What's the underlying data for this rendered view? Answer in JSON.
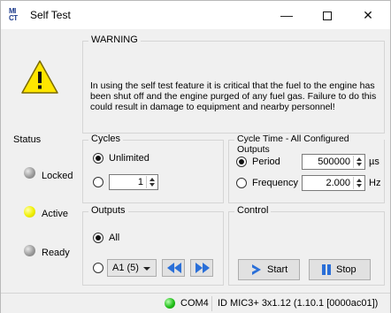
{
  "window": {
    "title": "Self Test",
    "app_icon_text_top": "MI",
    "app_icon_text_bottom": "CT",
    "minimize": "—",
    "close": "✕"
  },
  "warning": {
    "label": "WARNING",
    "text": "In using the self test feature it is critical that the fuel to the engine has been shut off and the engine purged of any fuel gas. Failure to do this could result in damage to equipment and nearby personnel!",
    "icon": "warning-triangle-icon",
    "icon_symbol": "!"
  },
  "status": {
    "label": "Status",
    "items": [
      {
        "label": "Locked",
        "color": "gray"
      },
      {
        "label": "Active",
        "color": "yellow"
      },
      {
        "label": "Ready",
        "color": "gray"
      }
    ]
  },
  "cycles": {
    "label": "Cycles",
    "unlimited_label": "Unlimited",
    "unlimited_selected": true,
    "count_value": "1"
  },
  "cycle_time": {
    "label": "Cycle Time - All Configured Outputs",
    "period_label": "Period",
    "period_selected": true,
    "period_value": "500000",
    "period_unit": "µs",
    "frequency_label": "Frequency",
    "frequency_value": "2.000",
    "frequency_unit": "Hz"
  },
  "outputs": {
    "label": "Outputs",
    "all_label": "All",
    "all_selected": true,
    "selected_output": "A1 (5)"
  },
  "control": {
    "label": "Control",
    "start_label": "Start",
    "stop_label": "Stop"
  },
  "statusbar": {
    "port": "COM4",
    "device_info": "ID MIC3+ 3x1.12 (1.10.1 [0000ac01])",
    "connection_color": "#22c01a"
  }
}
